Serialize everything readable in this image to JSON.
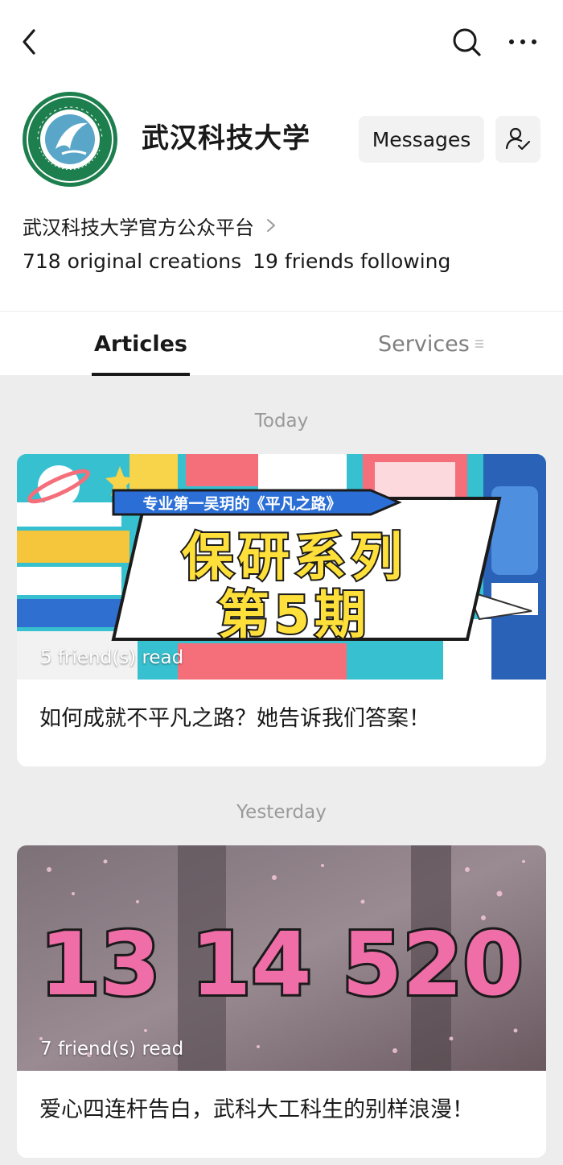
{
  "nav": {
    "back_icon": "back-arrow-icon",
    "search_icon": "search-icon",
    "more_icon": "more-dots-icon"
  },
  "profile": {
    "name": "武汉科技大学",
    "logo_icon": "university-seal-logo",
    "messages_label": "Messages",
    "follow_icon": "user-check-icon",
    "description": "武汉科技大学官方公众平台",
    "original_creations": "718 original creations",
    "friends_following": "19 friends following"
  },
  "tabs": [
    {
      "label": "Articles",
      "active": true
    },
    {
      "label": "Services",
      "active": false,
      "icon": "menu-lines-icon"
    }
  ],
  "feed": [
    {
      "date": "Today",
      "cover_banner": "专业第一吴玥的《平凡之路》",
      "cover_headline_1": "保研系列",
      "cover_headline_2": "第5期",
      "read_count": "5 friend(s) read",
      "title": "如何成就不平凡之路？她告诉我们答案！"
    },
    {
      "date": "Yesterday",
      "cover_headline": "13 14 520",
      "read_count": "7 friend(s) read",
      "title": "爱心四连杆告白，武科大工科生的别样浪漫！"
    }
  ],
  "colors": {
    "accent_blue": "#2b6fd6",
    "headline_yellow": "#ffe03a",
    "headline_pink": "#f06ea8",
    "logo_green": "#1e7f4e"
  }
}
